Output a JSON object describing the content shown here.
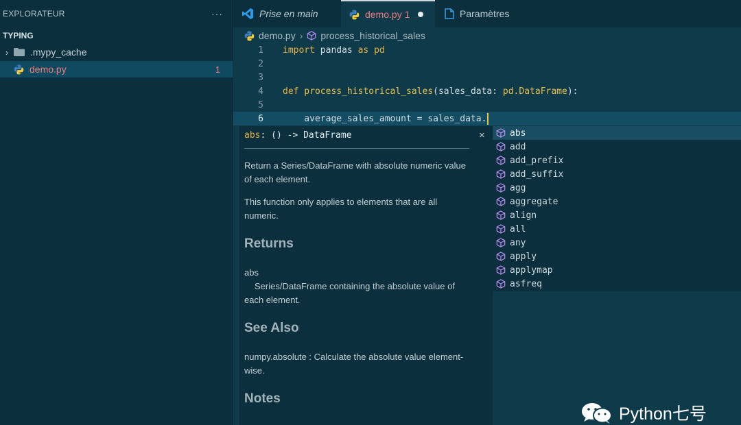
{
  "sidebar": {
    "header": "EXPLORATEUR",
    "more": "···",
    "section": "TYPING",
    "items": [
      {
        "label": ".mypy_cache",
        "type": "folder"
      },
      {
        "label": "demo.py",
        "type": "python-file",
        "problems": "1"
      }
    ]
  },
  "tabs": [
    {
      "label": "Prise en main",
      "icon": "vscode-icon"
    },
    {
      "label": "demo.py 1",
      "icon": "python-icon",
      "dirty": true
    },
    {
      "label": "Paramètres",
      "icon": "file-icon"
    }
  ],
  "breadcrumb": {
    "file": "demo.py",
    "separator": "›",
    "symbol": "process_historical_sales"
  },
  "editor": {
    "lines": [
      {
        "num": "1",
        "kw": "import",
        "text": " pandas ",
        "kw2": "as",
        "text2": " pd"
      },
      {
        "num": "2"
      },
      {
        "num": "3"
      },
      {
        "num": "4",
        "kw": "def",
        "fn": " process_historical_sales",
        "text": "(sales_data: ",
        "ty": "pd.DataFrame",
        "text2": "):"
      },
      {
        "num": "5"
      },
      {
        "num": "6",
        "text": "    average_sales_amount = sales_data."
      }
    ]
  },
  "docs": {
    "signature_name": "abs",
    "signature_rest": ": () -> DataFrame",
    "close": "×",
    "p1": "Return a Series/DataFrame with absolute numeric value of each element.",
    "p2": "This function only applies to elements that are all numeric.",
    "h_returns": "Returns",
    "returns_name": "abs",
    "returns_desc": "Series/DataFrame containing the absolute value of each element.",
    "h_see_also": "See Also",
    "see_also": "numpy.absolute : Calculate the absolute value element-wise.",
    "h_notes": "Notes"
  },
  "suggestions": [
    "abs",
    "add",
    "add_prefix",
    "add_suffix",
    "agg",
    "aggregate",
    "align",
    "all",
    "any",
    "apply",
    "applymap",
    "asfreq"
  ],
  "watermark": "Python七号",
  "colors": {
    "background": "#0f3a4a",
    "sidebar": "#0b2f3d",
    "keyword": "#e8b13f",
    "error": "#f07c7c",
    "method_icon": "#b98cf0"
  }
}
